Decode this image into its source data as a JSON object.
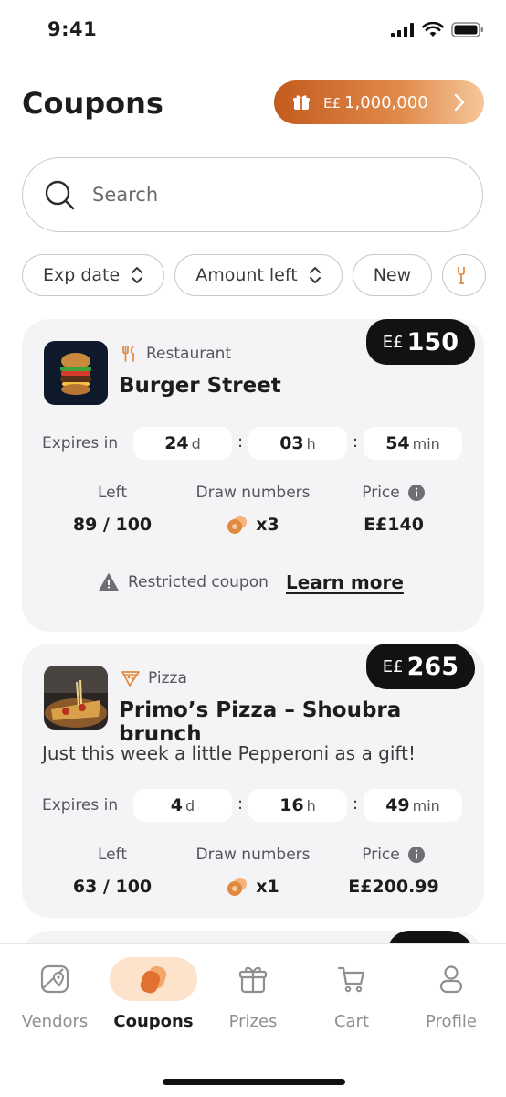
{
  "status_bar": {
    "time": "9:41"
  },
  "header": {
    "title": "Coupons",
    "balance": {
      "currency": "E£",
      "amount": "1,000,000"
    }
  },
  "search": {
    "placeholder": "Search",
    "value": ""
  },
  "filters": [
    {
      "label": "Exp date"
    },
    {
      "label": "Amount left"
    },
    {
      "label": "New"
    }
  ],
  "coupons": [
    {
      "category": "Restaurant",
      "vendor": "Burger Street",
      "promo": "",
      "badge_currency": "E£",
      "badge_value": "150",
      "expires_label": "Expires in",
      "days": "24",
      "days_unit": "d",
      "hours": "03",
      "hours_unit": "h",
      "minutes": "54",
      "minutes_unit": "min",
      "left_label": "Left",
      "left_value": "89 / 100",
      "draw_label": "Draw numbers",
      "draw_value": "x3",
      "price_label": "Price",
      "price_value": "E£140",
      "restricted_text": "Restricted coupon",
      "learn_more": "Learn more"
    },
    {
      "category": "Pizza",
      "vendor": "Primo’s Pizza – Shoubra brunch",
      "promo": "Just this week a little Pepperoni as a gift!",
      "badge_currency": "E£",
      "badge_value": "265",
      "expires_label": "Expires in",
      "days": "4",
      "days_unit": "d",
      "hours": "16",
      "hours_unit": "h",
      "minutes": "49",
      "minutes_unit": "min",
      "left_label": "Left",
      "left_value": "63 / 100",
      "draw_label": "Draw numbers",
      "draw_value": "x1",
      "price_label": "Price",
      "price_value": "E£200.99"
    }
  ],
  "tab_bar": {
    "items": [
      {
        "label": "Vendors",
        "icon": "vendors-map-icon"
      },
      {
        "label": "Coupons",
        "icon": "coupons-icon",
        "active": true
      },
      {
        "label": "Prizes",
        "icon": "gift-icon"
      },
      {
        "label": "Cart",
        "icon": "cart-icon"
      },
      {
        "label": "Profile",
        "icon": "profile-icon"
      }
    ]
  },
  "colors": {
    "accent": "#E0893F",
    "badge": "#121212",
    "card": "#F4F4F6",
    "active_tab_bg": "#FDE3CC"
  }
}
